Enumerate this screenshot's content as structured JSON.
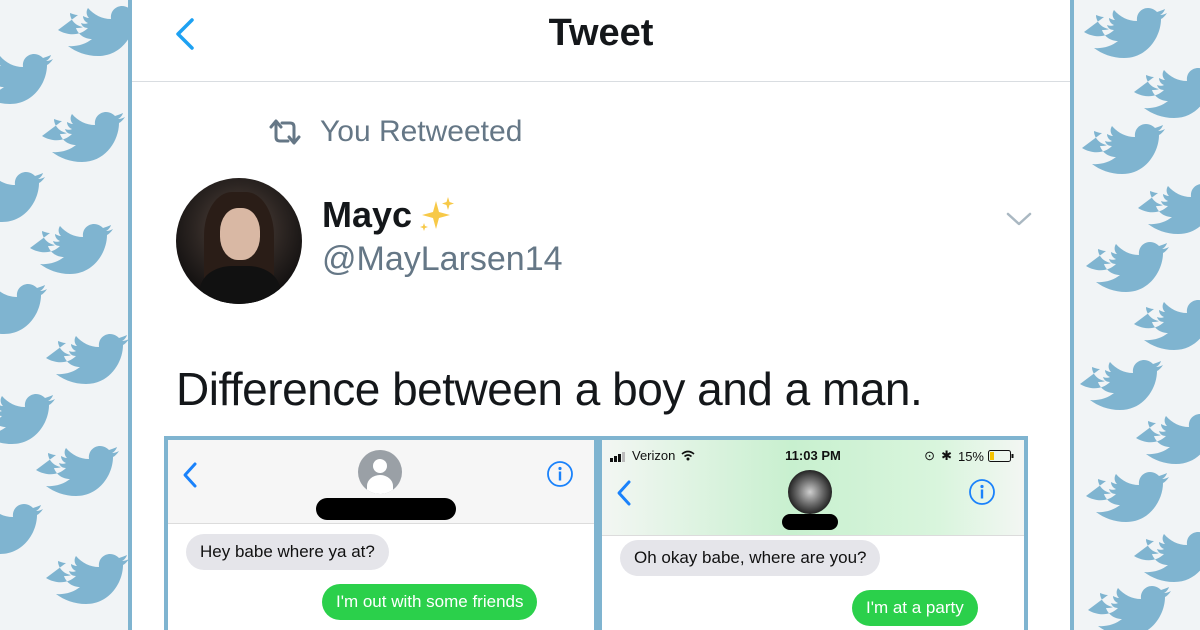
{
  "header": {
    "title": "Tweet"
  },
  "retweet": {
    "label": "You Retweeted"
  },
  "user": {
    "display_name": "Mayc",
    "handle": "@MayLarsen14"
  },
  "tweet": {
    "text": "Difference between a boy and a man."
  },
  "screenshot_left": {
    "messages": [
      {
        "direction": "incoming",
        "text": "Hey babe where ya at?"
      },
      {
        "direction": "outgoing",
        "text": "I'm out with some friends"
      }
    ]
  },
  "screenshot_right": {
    "status": {
      "carrier": "Verizon",
      "time": "11:03 PM",
      "battery": "15%"
    },
    "messages": [
      {
        "direction": "incoming",
        "text": "Oh okay babe, where are you?"
      },
      {
        "direction": "outgoing",
        "text": "I'm at a party"
      }
    ]
  },
  "icons": {
    "back": "chevron-left-icon",
    "retweet": "retweet-icon",
    "sparkles": "sparkles-icon",
    "more": "chevron-down-icon",
    "info": "info-icon",
    "pattern": "bird-icon"
  },
  "colors": {
    "accent": "#1da1f2",
    "pattern_bird": "#7fb4d0",
    "pattern_bg": "#f1f4f6",
    "imessage_green": "#2bd04b",
    "imessage_gray": "#e5e5ea",
    "text_secondary": "#657786"
  }
}
